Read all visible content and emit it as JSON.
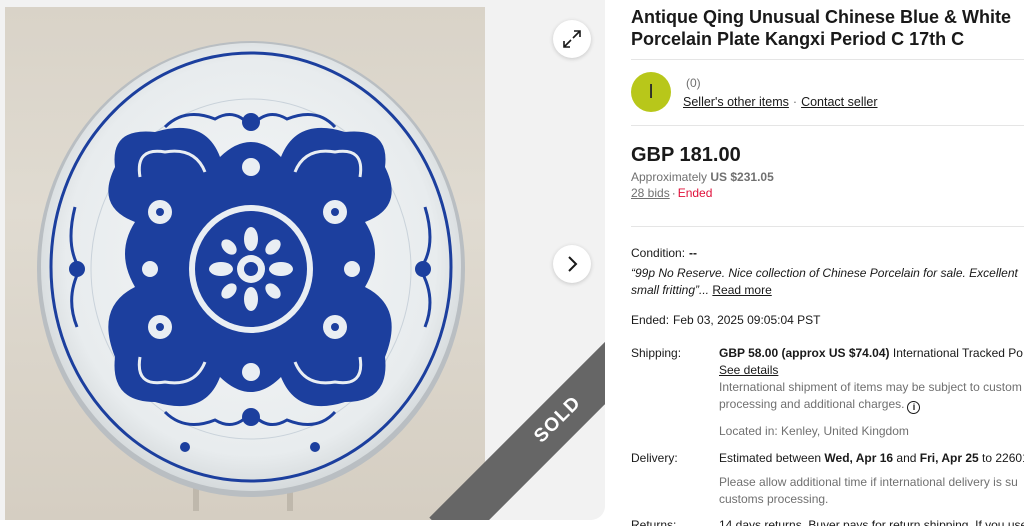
{
  "listing": {
    "title_line1": "Antique Qing Unusual Chinese Blue & White",
    "title_line2": "Porcelain Plate Kangxi Period C 17th C"
  },
  "seller": {
    "avatar_letter": "I",
    "feedback": "(0)",
    "other_items_link": "Seller's other items",
    "contact_link": "Contact seller",
    "avatar_color": "#b8c71a"
  },
  "price": {
    "amount": "GBP 181.00",
    "approx_prefix": "Approximately",
    "approx_value": "US $231.05",
    "bids": "28 bids",
    "status": "Ended"
  },
  "condition": {
    "label": "Condition:",
    "value": "--",
    "quote_line1": "“99p No Reserve. Nice collection of Chinese Porcelain for sale. Excellent",
    "quote_line2": "small fritting”",
    "ellipsis": "...",
    "read_more": "Read more"
  },
  "ended": {
    "label": "Ended:",
    "value": "Feb 03, 2025 09:05:04 PST"
  },
  "shipping": {
    "label": "Shipping:",
    "cost_bold": "GBP 58.00 (approx US $74.04)",
    "cost_rest": " International Tracked Po",
    "see_details": "See details",
    "note_line1": "International shipment of items may be subject to custom",
    "note_line2": "processing and additional charges.",
    "location": "Located in: Kenley, United Kingdom"
  },
  "delivery": {
    "label": "Delivery:",
    "prefix": "Estimated between ",
    "start": "Wed, Apr 16",
    "and": " and ",
    "end": "Fri, Apr 25",
    "suffix": " to 22601",
    "note_line1": "Please allow additional time if international delivery is su",
    "note_line2": "customs processing."
  },
  "returns": {
    "label": "Returns:",
    "value": "14 days returns. Buyer pays for return shipping. If you use"
  },
  "gallery": {
    "sold_label": "SOLD",
    "expand_icon": "expand-icon",
    "next_icon": "chevron-right-icon"
  },
  "colors": {
    "accent_ended": "#e0103a",
    "porcelain_blue": "#1c3f9e"
  }
}
